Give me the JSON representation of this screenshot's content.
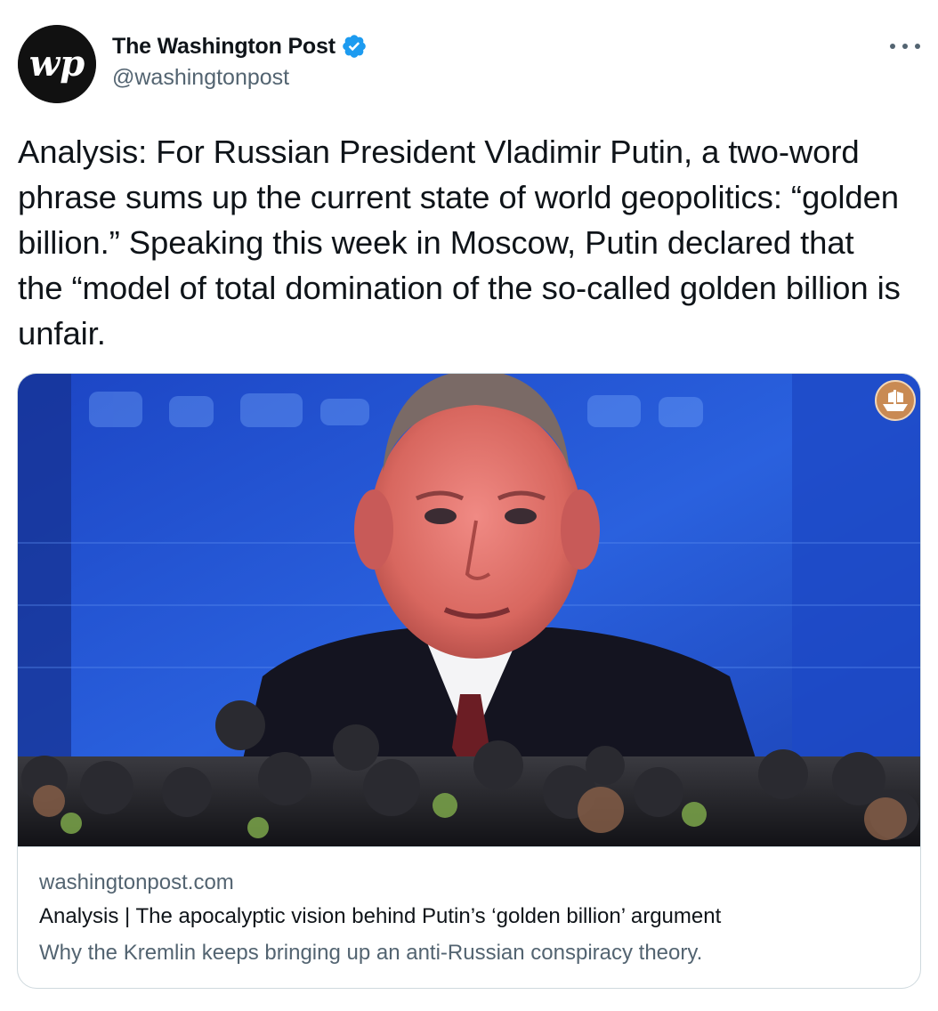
{
  "tweet": {
    "author": {
      "display_name": "The Washington Post",
      "handle": "@washingtonpost",
      "avatar_text": "wp",
      "verified": true,
      "verified_icon": "verified-badge-icon"
    },
    "more_icon": "ellipsis-icon",
    "text": "Analysis: For Russian President Vladimir Putin, a two-word phrase sums up the current state of world geopolitics: “golden billion.” Speaking this week in Moscow, Putin declared that the “model of total domination of the so-called golden billion is unfair.",
    "card": {
      "domain": "washingtonpost.com",
      "title": "Analysis | The apocalyptic vision behind Putin’s ‘golden billion’ argument",
      "description": "Why the Kremlin keeps bringing up an anti-Russian conspiracy theory.",
      "image_icon": "forum-ship-logo-icon"
    }
  },
  "colors": {
    "text_primary": "#0f1419",
    "text_secondary": "#536471",
    "verified_blue": "#1d9bf0",
    "border": "#cfd9de",
    "screen_blue": "#1f4fd0"
  }
}
